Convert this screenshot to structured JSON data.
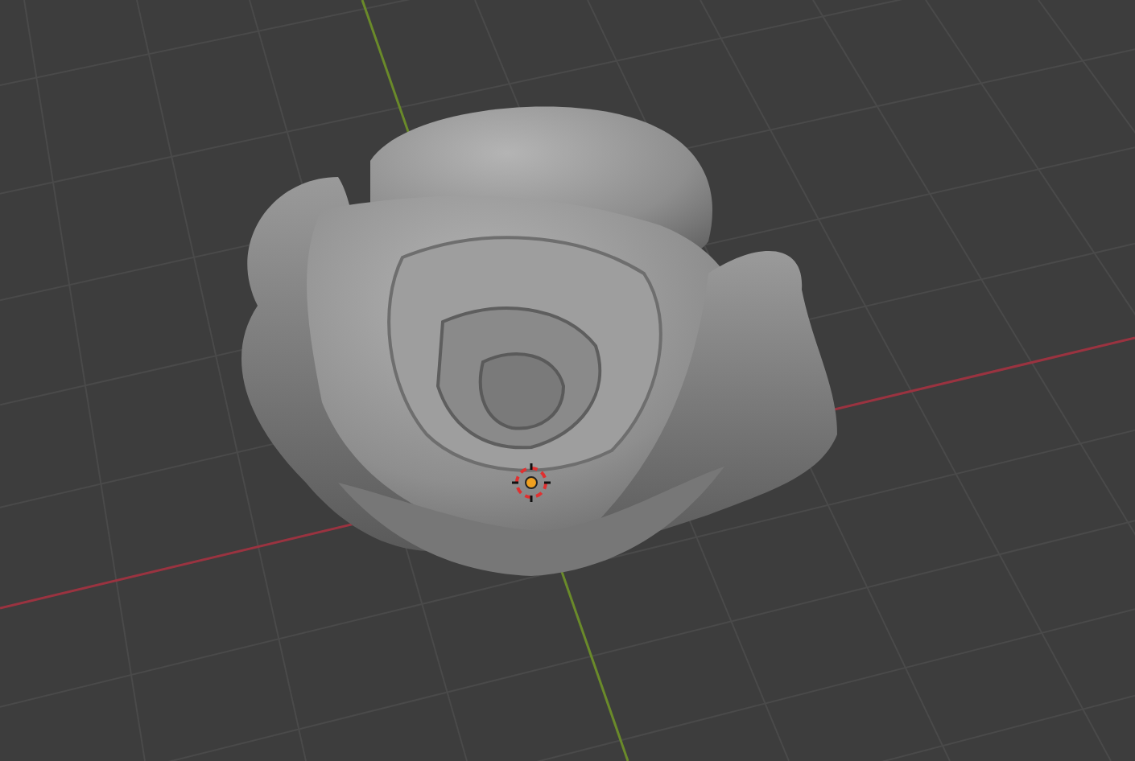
{
  "viewport": {
    "show_grid": true,
    "show_axes": true,
    "show_3d_cursor": true,
    "show_origin": true
  }
}
